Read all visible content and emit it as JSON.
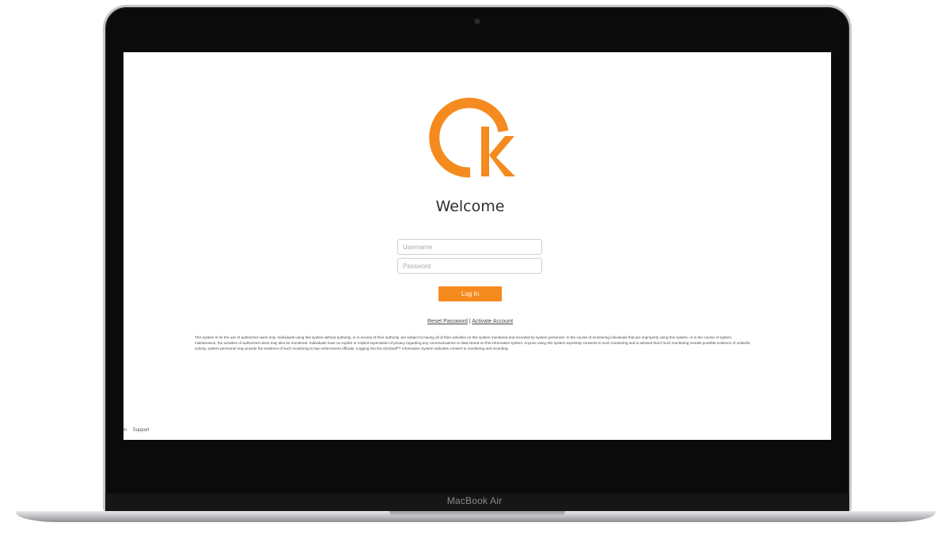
{
  "device": {
    "label": "MacBook Air"
  },
  "brand": {
    "logo_icon": "ck-circle-logo-icon",
    "accent_color": "#f58a1f"
  },
  "login": {
    "heading": "Welcome",
    "username_placeholder": "Username",
    "password_placeholder": "Password",
    "submit_label": "Log In"
  },
  "links": {
    "reset_password": "Reset Password",
    "separator": "|",
    "activate_account": "Activate Account"
  },
  "disclaimer": "This system is for the use of authorized users only. Individuals using this system without authority, or in excess of their authority, are subject to having all of their activities on this system monitored and recorded by system personnel. In the course of monitoring individuals that are improperly using this system, or in the course of system maintenance, the activities of authorized users may also be monitored. Individuals have no explicit or implicit expectation of privacy regarding any communications or data stored on this information system. Anyone using this system expressly consents to such monitoring and is advised that if such monitoring reveals possible evidence of unlawful activity, system personnel may provide the evidence of such monitoring to law enforcement officials. Logging into the clickStaff™ Information System indicates consent to monitoring and recording.",
  "footer": {
    "items": [
      "gin",
      "Support"
    ]
  }
}
